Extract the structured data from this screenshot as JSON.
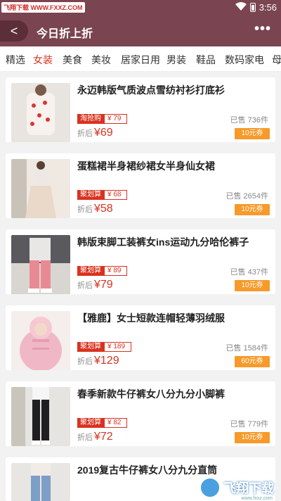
{
  "status_bar": {
    "watermark": "飞翔下载 WWW.FXXZ.COM",
    "time": "3:56"
  },
  "app_bar": {
    "back_label": "<",
    "title": "今日折上折",
    "more_label": "•••"
  },
  "tabs": [
    "精选",
    "女装",
    "美食",
    "美妆",
    "居家日用",
    "男装",
    "鞋品",
    "数码家电",
    "母"
  ],
  "products": [
    {
      "title": "永迈韩版气质波点雪纺衬衫打底衫",
      "tag": "淘抢购",
      "orig_price": "¥ 79",
      "price_prefix": "折后",
      "price": "¥69",
      "sold": "已售 736件",
      "coupon": "10元券"
    },
    {
      "title": "蛋糕裙半身裙纱裙女半身仙女裙",
      "tag": "聚划算",
      "orig_price": "¥ 68",
      "price_prefix": "折后",
      "price": "¥58",
      "sold": "已售 2654件",
      "coupon": "10元券"
    },
    {
      "title": "韩版束脚工装裤女ins运动九分哈伦裤子",
      "tag": "聚划算",
      "orig_price": "¥ 89",
      "price_prefix": "折后",
      "price": "¥79",
      "sold": "已售 437件",
      "coupon": "10元券"
    },
    {
      "title": "【雅鹿】女士短款连帽轻薄羽绒服",
      "tag": "聚划算",
      "orig_price": "¥ 189",
      "price_prefix": "折后",
      "price": "¥129",
      "sold": "已售 1584件",
      "coupon": "60元券"
    },
    {
      "title": "春季新款牛仔裤女八分九分小脚裤",
      "tag": "聚划算",
      "orig_price": "¥ 82",
      "price_prefix": "折后",
      "price": "¥72",
      "sold": "已售 779件",
      "coupon": "10元券"
    },
    {
      "title": "2019复古牛仔裤女八分九分直筒",
      "tag": "",
      "orig_price": "",
      "price_prefix": "",
      "price": "",
      "sold": "",
      "coupon": ""
    }
  ],
  "corner_logo": {
    "text": "飞翔下载",
    "url": "www.fxxz.com"
  },
  "colors": {
    "app_bar": "#7a4450",
    "accent": "#d9321f",
    "coupon": "#f79a2a"
  }
}
